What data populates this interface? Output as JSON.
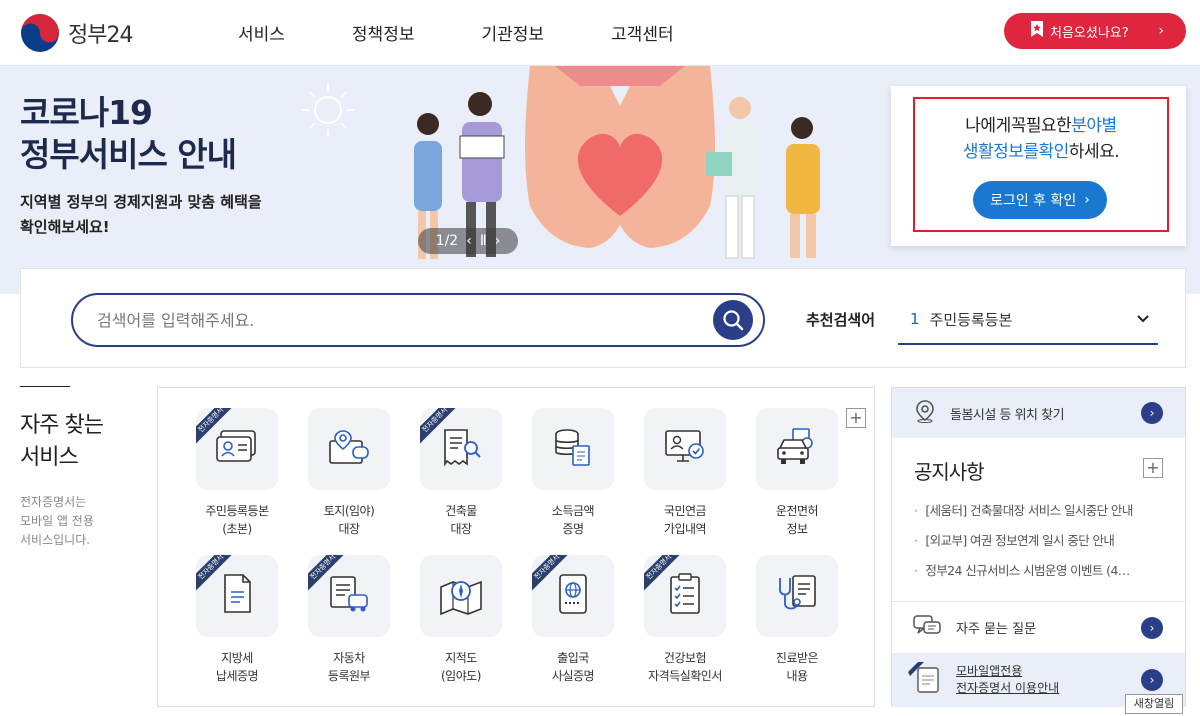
{
  "header": {
    "logo_text": "정부24",
    "nav": [
      "서비스",
      "정책정보",
      "기관정보",
      "고객센터"
    ],
    "first_visit_label": "처음오셨나요?"
  },
  "banner": {
    "title_line1": "코로나19",
    "title_line2": "정부서비스 안내",
    "sub_line1": "지역별 정부의 경제지원과 맞춤 혜택을",
    "sub_line2": "확인해보세요!",
    "pager": "1/2"
  },
  "login_box": {
    "msg_part1": "나에게꼭필요한",
    "msg_highlight1": "분야별",
    "msg_highlight2": "생활정보를확인",
    "msg_part2": "하세요.",
    "button_label": "로그인 후 확인"
  },
  "search": {
    "placeholder": "검색어를 입력해주세요.",
    "recommend_label": "추천검색어",
    "recommend_rank": "1",
    "recommend_value": "주민등록등본"
  },
  "frequent": {
    "title_line1": "자주 찾는",
    "title_line2": "서비스",
    "desc_line1": "전자증명서는",
    "desc_line2": "모바일 앱 전용",
    "desc_line3": "서비스입니다.",
    "ribbon_label": "전자증명서",
    "services": [
      {
        "line1": "주민등록등본",
        "line2": "(초본)",
        "icon": "id-card-icon",
        "ribbon": true
      },
      {
        "line1": "토지(임야)",
        "line2": "대장",
        "icon": "land-map-icon",
        "ribbon": false
      },
      {
        "line1": "건축물",
        "line2": "대장",
        "icon": "building-document-icon",
        "ribbon": true
      },
      {
        "line1": "소득금액",
        "line2": "증명",
        "icon": "coins-document-icon",
        "ribbon": false
      },
      {
        "line1": "국민연금",
        "line2": "가입내역",
        "icon": "pension-icon",
        "ribbon": false
      },
      {
        "line1": "운전면허",
        "line2": "정보",
        "icon": "car-license-icon",
        "ribbon": false
      },
      {
        "line1": "지방세",
        "line2": "납세증명",
        "icon": "tax-document-icon",
        "ribbon": true
      },
      {
        "line1": "자동차",
        "line2": "등록원부",
        "icon": "car-registration-icon",
        "ribbon": true
      },
      {
        "line1": "지적도",
        "line2": "(임야도)",
        "icon": "compass-map-icon",
        "ribbon": false
      },
      {
        "line1": "출입국",
        "line2": "사실증명",
        "icon": "passport-icon",
        "ribbon": true
      },
      {
        "line1": "건강보험",
        "line2": "자격득실확인서",
        "icon": "checklist-icon",
        "ribbon": true
      },
      {
        "line1": "진료받은",
        "line2": "내용",
        "icon": "stethoscope-icon",
        "ribbon": false
      }
    ]
  },
  "right": {
    "care_label": "돌봄시설 등 위치 찾기",
    "notice_title": "공지사항",
    "notices": [
      "[세움터] 건축물대장 서비스 일시중단 안내",
      "[외교부] 여권 정보연계 일시 중단 안내",
      "정부24 신규서비스 시범운영 이벤트 (4…"
    ],
    "faq_label": "자주 묻는 질문",
    "mobile_line1": "모바일앱전용",
    "mobile_line2": "전자증명서 이용안내",
    "tooltip": "새창열림"
  },
  "colors": {
    "brand_red": "#e0253f",
    "navy": "#2b3e8a",
    "blue": "#1a78d0"
  }
}
